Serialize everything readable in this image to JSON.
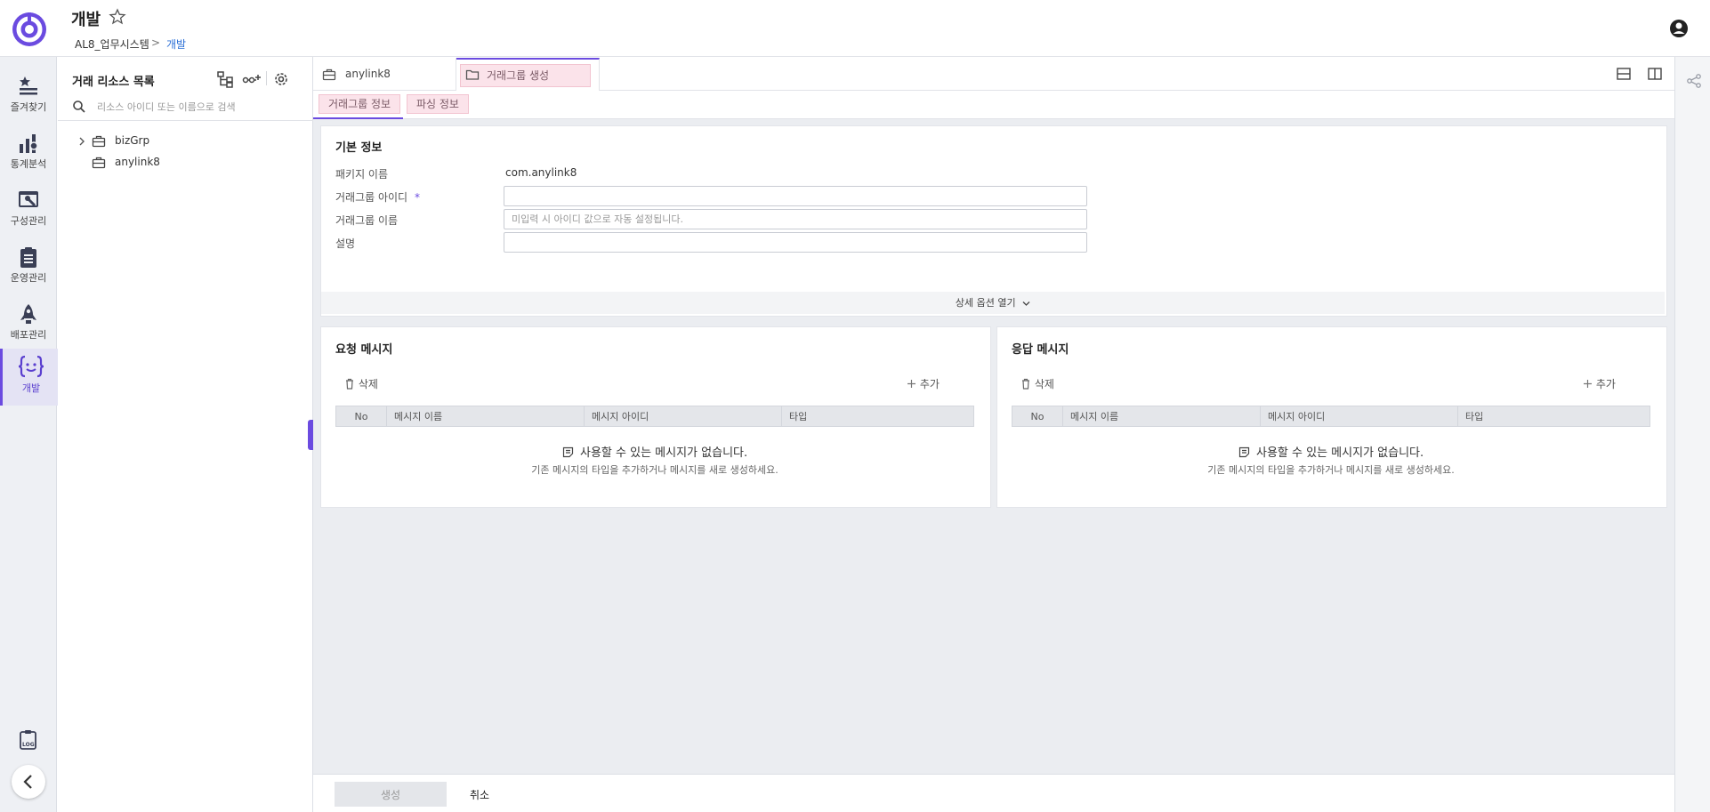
{
  "header": {
    "title": "개발",
    "breadcrumb": [
      "AL8_업무시스템",
      "개발"
    ],
    "breadcrumb_separator": ">"
  },
  "nav": {
    "items": [
      {
        "label": "즐겨찾기",
        "icon": "star-list-icon"
      },
      {
        "label": "통계분석",
        "icon": "chart-icon"
      },
      {
        "label": "구성관리",
        "icon": "config-window-icon"
      },
      {
        "label": "운영관리",
        "icon": "clipboard-icon"
      },
      {
        "label": "배포관리",
        "icon": "rocket-icon"
      },
      {
        "label": "개발",
        "icon": "code-brackets-icon",
        "active": true
      }
    ],
    "bottom_icons": [
      "log-icon",
      "collapse-icon"
    ],
    "accent_color": "#6b4be0"
  },
  "resource_panel": {
    "title": "거래 리소스 목록",
    "search_placeholder": "리소스 아이디 또는 이름으로 검색",
    "tree": [
      {
        "label": "bizGrp",
        "expandable": true,
        "icon": "briefcase-icon"
      },
      {
        "label": "anylink8",
        "expandable": false,
        "icon": "briefcase-icon"
      }
    ]
  },
  "tabs": [
    {
      "label": "anylink8",
      "icon": "briefcase-icon",
      "active": false
    },
    {
      "label": "거래그룹 생성",
      "icon": "folder-icon",
      "active": true
    }
  ],
  "subtabs": [
    {
      "label": "거래그룹 정보",
      "active": true
    },
    {
      "label": "파싱 정보",
      "active": false
    }
  ],
  "basic_info": {
    "title": "기본 정보",
    "package_label": "패키지 이름",
    "package_value": "com.anylink8",
    "group_id_label": "거래그룹 아이디",
    "required_mark": "*",
    "group_id_value": "",
    "group_name_label": "거래그룹 이름",
    "group_name_placeholder": "미입력 시 아이디 값으로 자동 설정됩니다.",
    "desc_label": "설명",
    "desc_value": "",
    "advanced_toggle": "상세 옵션 열기"
  },
  "request_msg": {
    "title": "요청 메시지",
    "delete_label": "삭제",
    "add_label": "추가",
    "columns": [
      "No",
      "메시지 이름",
      "메시지 아이디",
      "타입"
    ],
    "empty_title": "사용할 수 있는 메시지가 없습니다.",
    "empty_sub": "기존 메시지의 타입을 추가하거나 메시지를 새로 생성하세요."
  },
  "response_msg": {
    "title": "응답 메시지",
    "delete_label": "삭제",
    "add_label": "추가",
    "columns": [
      "No",
      "메시지 이름",
      "메시지 아이디",
      "타입"
    ],
    "empty_title": "사용할 수 있는 메시지가 없습니다.",
    "empty_sub": "기존 메시지의 타입을 추가하거나 메시지를 새로 생성하세요."
  },
  "footer": {
    "create_label": "생성",
    "cancel_label": "취소"
  }
}
